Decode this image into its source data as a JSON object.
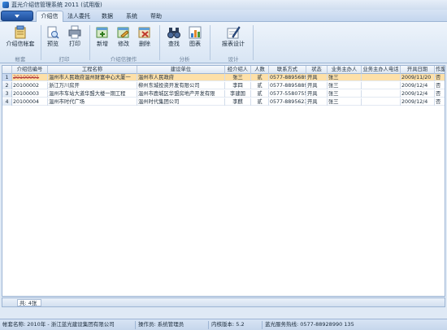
{
  "window": {
    "title": "蓝光介绍信管理系统 2011 (试用版)"
  },
  "tabs": [
    "介绍信",
    "法人委托",
    "数据",
    "系统",
    "帮助"
  ],
  "ribbon": {
    "buttons": {
      "letter_account": "介绍信帐套",
      "preview": "预览",
      "print": "打印",
      "add": "新增",
      "edit": "修改",
      "delete": "删除",
      "find": "查找",
      "chart": "图表",
      "report_design": "报表设计"
    },
    "groups": {
      "account": "帐套",
      "print": "打印",
      "letter_ops": "介绍信操作",
      "analysis": "分析",
      "design": "设计"
    }
  },
  "table": {
    "columns": [
      "介绍信编号",
      "工程名称",
      "建设单位",
      "经介绍人",
      "人数",
      "联系方式",
      "状态",
      "业务主办人",
      "业务主办人电话",
      "开具日期",
      "作废"
    ],
    "rows": [
      {
        "no": "1",
        "cells": [
          "20100001",
          "温州市人民政府温州财富中心大厦一",
          "温州市人民政府",
          "张三",
          "贰",
          "0577-8895689",
          "开具",
          "张三",
          "",
          "2009/11/20",
          "否"
        ]
      },
      {
        "no": "2",
        "cells": [
          "20100002",
          "浙江万川房开",
          "柳州东城投资开发有限公司",
          "李四",
          "贰",
          "0577-8895889",
          "开具",
          "张三",
          "",
          "2009/12/4",
          "否"
        ]
      },
      {
        "no": "3",
        "cells": [
          "20100003",
          "温州市车站大道华盟大楼一期工程",
          "温州市鹿城区华盟房地产开发有限",
          "李建国",
          "贰",
          "0577-5580755",
          "开具",
          "张三",
          "",
          "2009/12/4",
          "否"
        ]
      },
      {
        "no": "4",
        "cells": [
          "20100004",
          "温州市时代广场",
          "温州时代集团公司",
          "李麒",
          "贰",
          "0577-8895623",
          "开具",
          "张三",
          "",
          "2009/12/4",
          "否"
        ]
      }
    ]
  },
  "count_bar": {
    "text": "共: 4张"
  },
  "status": {
    "account": "帐套名称: 2010年 - 浙江蓝光建设集团有限公司",
    "operator": "操作员: 系统管理员",
    "version": "内核版本: 5.2",
    "hotline": "蓝光服务热线: 0577-88928990 135"
  },
  "colors": {
    "selected_row": "#fde0a8",
    "app_button": "#2a5fb0",
    "accent_red": "#c0392b"
  }
}
